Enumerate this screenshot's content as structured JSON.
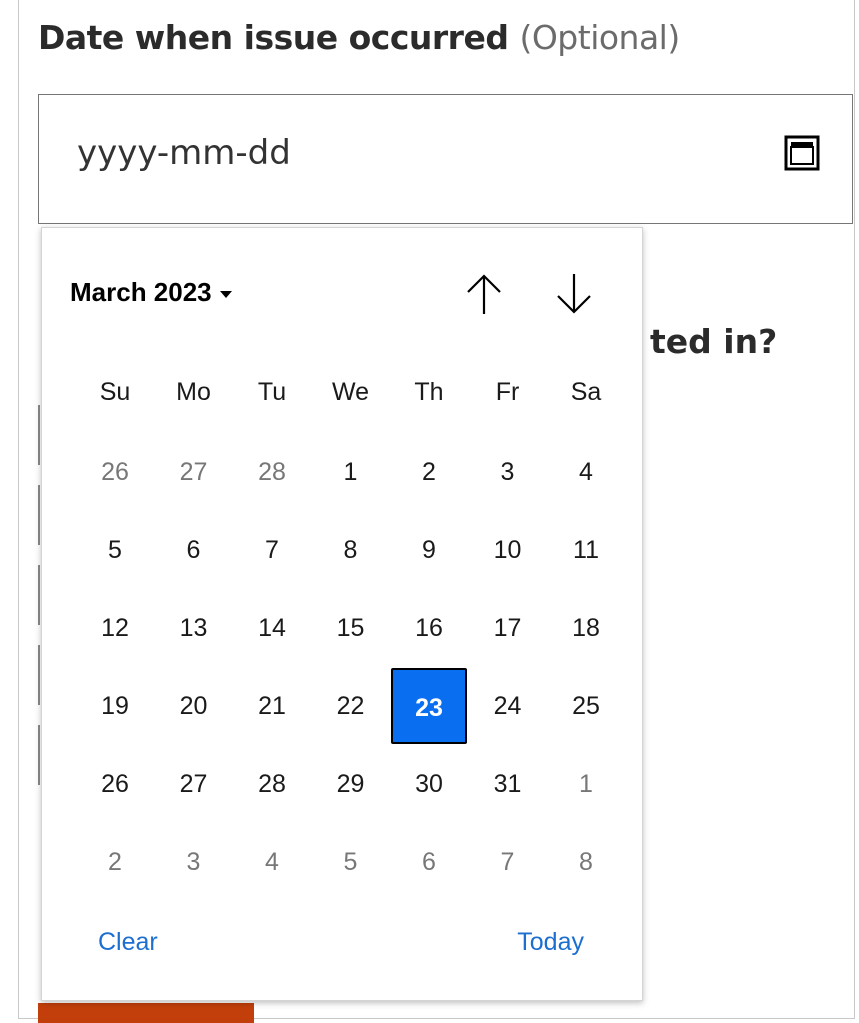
{
  "field": {
    "label": "Date when issue occurred",
    "optional": "(Optional)",
    "placeholder": "yyyy-mm-dd",
    "calendar_icon": "calendar-icon"
  },
  "background": {
    "partial_text": "ted in?"
  },
  "calendar": {
    "month_year": "March 2023",
    "weekdays": [
      "Su",
      "Mo",
      "Tu",
      "We",
      "Th",
      "Fr",
      "Sa"
    ],
    "weeks": [
      [
        "26",
        "27",
        "28",
        "1",
        "2",
        "3",
        "4"
      ],
      [
        "5",
        "6",
        "7",
        "8",
        "9",
        "10",
        "11"
      ],
      [
        "12",
        "13",
        "14",
        "15",
        "16",
        "17",
        "18"
      ],
      [
        "19",
        "20",
        "21",
        "22",
        "23",
        "24",
        "25"
      ],
      [
        "26",
        "27",
        "28",
        "29",
        "30",
        "31",
        "1"
      ],
      [
        "2",
        "3",
        "4",
        "5",
        "6",
        "7",
        "8"
      ]
    ],
    "selected": "23",
    "clear_label": "Clear",
    "today_label": "Today",
    "accent_color": "#0a6ef0",
    "link_color": "#1c6fd1"
  }
}
